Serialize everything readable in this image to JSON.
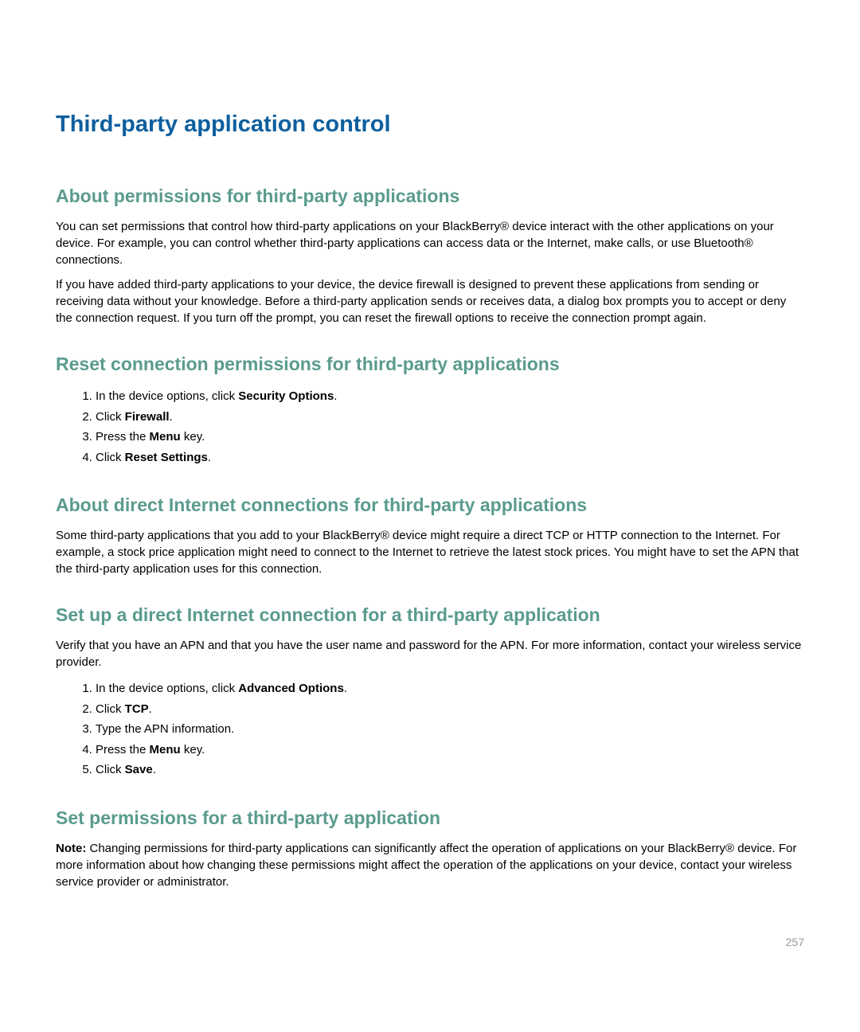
{
  "page_title": "Third-party application control",
  "sections": {
    "about_permissions": {
      "heading": "About permissions for third-party applications",
      "para1": "You can set permissions that control how third-party applications on your BlackBerry® device interact with the other applications on your device. For example, you can control whether third-party applications can access data or the Internet, make calls, or use Bluetooth® connections.",
      "para2": "If you have added third-party applications to your device, the device firewall is designed to prevent these applications from sending or receiving data without your knowledge. Before a third-party application sends or receives data, a dialog box prompts you to accept or deny the connection request. If you turn off the prompt, you can reset the firewall options to receive the connection prompt again."
    },
    "reset_connection": {
      "heading": "Reset connection permissions for third-party applications",
      "steps": {
        "s1_pre": "In the device options, click ",
        "s1_bold": "Security Options",
        "s1_post": ".",
        "s2_pre": "Click ",
        "s2_bold": "Firewall",
        "s2_post": ".",
        "s3_pre": "Press the ",
        "s3_bold": "Menu",
        "s3_post": " key.",
        "s4_pre": "Click ",
        "s4_bold": "Reset Settings",
        "s4_post": "."
      }
    },
    "about_direct": {
      "heading": "About direct Internet connections for third-party applications",
      "para1": "Some third-party applications that you add to your BlackBerry® device might require a direct TCP or HTTP connection to the Internet. For example, a stock price application might need to connect to the Internet to retrieve the latest stock prices. You might have to set the APN that the third-party application uses for this connection."
    },
    "setup_direct": {
      "heading": "Set up a direct Internet connection for a third-party application",
      "para1": "Verify that you have an APN and that you have the user name and password for the APN. For more information, contact your wireless service provider.",
      "steps": {
        "s1_pre": "In the device options, click ",
        "s1_bold": "Advanced Options",
        "s1_post": ".",
        "s2_pre": "Click ",
        "s2_bold": "TCP",
        "s2_post": ".",
        "s3": "Type the APN information.",
        "s4_pre": "Press the ",
        "s4_bold": "Menu",
        "s4_post": " key.",
        "s5_pre": "Click ",
        "s5_bold": "Save",
        "s5_post": "."
      }
    },
    "set_permissions": {
      "heading": "Set permissions for a third-party application",
      "note_label": "Note:",
      "note_text": "  Changing permissions for third-party applications can significantly affect the operation of applications on your BlackBerry® device. For more information about how changing these permissions might affect the operation of the applications on your device, contact your wireless service provider or administrator."
    }
  },
  "page_number": "257"
}
